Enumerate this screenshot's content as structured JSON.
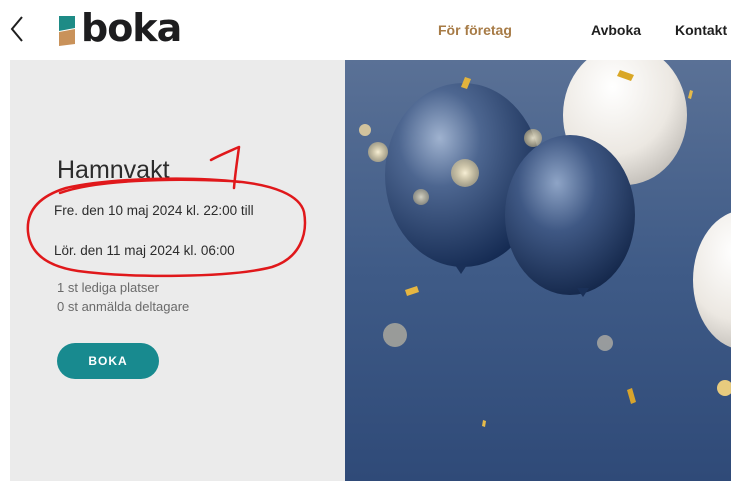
{
  "header": {
    "logo_text": "boka",
    "nav": {
      "for_foretag": "För företag",
      "avboka": "Avboka",
      "kontakt": "Kontakt"
    },
    "back_icon": "chevron-left-icon"
  },
  "event": {
    "title": "Hamnvakt",
    "start": "Fre. den 10 maj 2024 kl. 22:00 till",
    "end": "Lör. den 11 maj 2024 kl. 06:00",
    "available_spots": "1 st lediga platser",
    "registered": "0 st anmälda deltagare",
    "book_button": "BOKA"
  },
  "annotation": {
    "number": "1",
    "color": "#e0181b"
  },
  "colors": {
    "accent_gold": "#a77b46",
    "button_teal": "#188a8f",
    "panel_gray": "#ebebeb",
    "background_blue": "#3d5a86"
  }
}
